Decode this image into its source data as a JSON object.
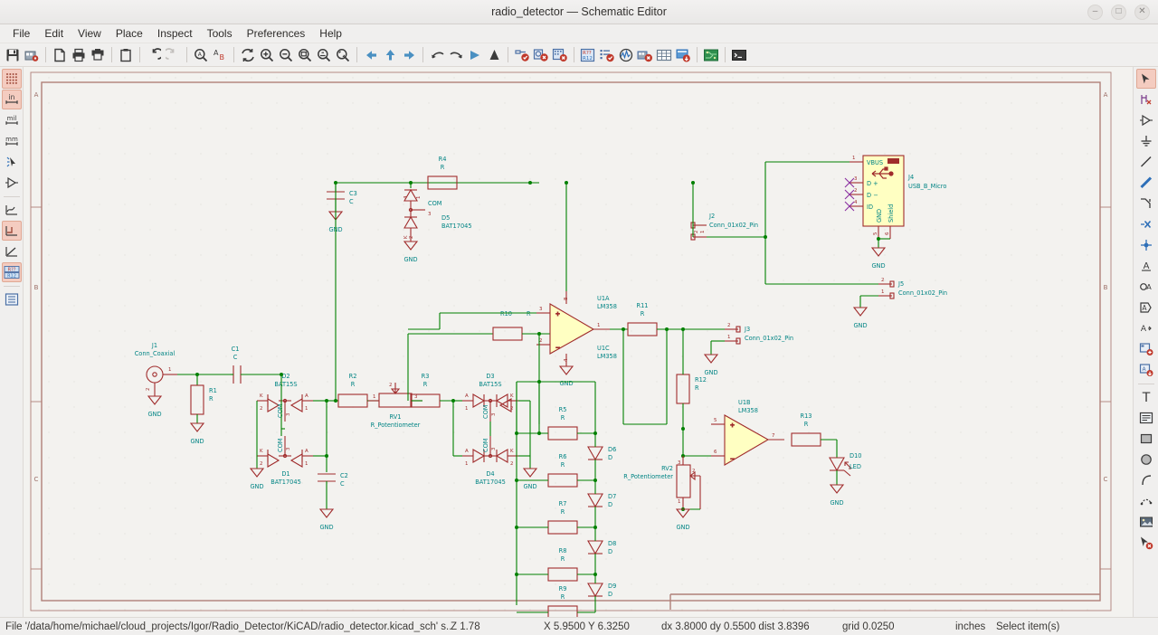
{
  "window": {
    "title": "radio_detector — Schematic Editor",
    "controls": [
      {
        "name": "minimize-button",
        "glyph": "–"
      },
      {
        "name": "maximize-button",
        "glyph": "□"
      },
      {
        "name": "close-button",
        "glyph": "✕"
      }
    ]
  },
  "menubar": {
    "items": [
      "File",
      "Edit",
      "View",
      "Place",
      "Inspect",
      "Tools",
      "Preferences",
      "Help"
    ]
  },
  "toolbar": {
    "groups": [
      [
        "save-icon",
        "project-manager-icon"
      ],
      [
        "new-sheet-icon",
        "print-icon",
        "plot-icon"
      ],
      [
        "paste-icon"
      ],
      [
        "undo-icon",
        "redo-icon"
      ],
      [
        "find-icon",
        "find-replace-icon"
      ],
      [
        "refresh-icon",
        "zoom-in-icon",
        "zoom-out-icon",
        "zoom-fit-icon",
        "zoom-objects-icon",
        "zoom-area-icon"
      ],
      [
        "back-icon",
        "up-icon",
        "forward-icon"
      ],
      [
        "rotate-ccw-icon",
        "rotate-cw-icon",
        "mirror-h-icon",
        "mirror-v-icon"
      ],
      [
        "annotate-icon",
        "symbol-checker-icon",
        "erc-icon"
      ],
      [
        "bom-icon",
        "fields-editor-icon",
        "simulator-icon",
        "assign-footprints-icon",
        "spreadsheet-icon",
        "netlist-icon"
      ],
      [
        "pcb-editor-icon"
      ],
      [
        "scripting-console-icon"
      ]
    ]
  },
  "left_toolbar": {
    "items": [
      {
        "name": "toggle-grid-icon",
        "active": true
      },
      {
        "name": "units-inches-icon",
        "label": "in",
        "active": true
      },
      {
        "name": "units-mils-icon",
        "label": "mil",
        "active": false
      },
      {
        "name": "units-mm-icon",
        "label": "mm",
        "active": false
      },
      {
        "name": "cursor-full-window-icon",
        "active": false
      },
      {
        "name": "hidden-pins-icon",
        "active": false
      },
      {
        "name": "free-angle-wires-icon",
        "active": false
      },
      {
        "name": "h-v-wires-icon",
        "active": true
      },
      {
        "name": "any-angle-wires-icon",
        "active": false
      },
      {
        "name": "show-pin-numbers-icon",
        "active": true
      },
      {
        "name": "show-hierarchy-navigator-icon",
        "active": false
      }
    ]
  },
  "right_toolbar": {
    "items": [
      {
        "name": "select-tool-icon",
        "active": true
      },
      {
        "name": "highlight-net-icon",
        "active": false
      },
      {
        "name": "place-symbol-icon",
        "active": false
      },
      {
        "name": "place-power-port-icon",
        "active": false
      },
      {
        "name": "draw-wire-icon",
        "active": false
      },
      {
        "name": "draw-bus-icon",
        "active": false
      },
      {
        "name": "wire-to-bus-entry-icon",
        "active": false
      },
      {
        "name": "no-connect-flag-icon",
        "active": false
      },
      {
        "name": "junction-icon",
        "active": false
      },
      {
        "name": "net-label-icon",
        "active": false
      },
      {
        "name": "global-label-icon",
        "active": false
      },
      {
        "name": "hierarchical-label-icon",
        "active": false
      },
      {
        "name": "text-label-icon",
        "active": false
      },
      {
        "name": "hierarchical-sheet-icon",
        "active": false
      },
      {
        "name": "import-sheet-pin-icon",
        "active": false
      },
      {
        "name": "draw-text-icon",
        "active": false
      },
      {
        "name": "draw-textbox-icon",
        "active": false
      },
      {
        "name": "draw-rectangle-icon",
        "active": false
      },
      {
        "name": "draw-circle-icon",
        "active": false
      },
      {
        "name": "draw-arc-icon",
        "active": false
      },
      {
        "name": "draw-lines-icon",
        "active": false
      },
      {
        "name": "place-image-icon",
        "active": false
      },
      {
        "name": "delete-tool-icon",
        "active": false
      }
    ]
  },
  "statusbar": {
    "file": "File '/data/home/michael/cloud_projects/Igor/Radio_Detector/KiCAD/radio_detector.kicad_sch' s...",
    "zoom": "Z 1.78",
    "absolute": "X 5.9500  Y 6.3250",
    "relative": "dx 3.8000  dy 0.5500  dist 3.8396",
    "grid": "grid 0.0250",
    "units": "inches",
    "tool": "Select item(s)"
  },
  "sheet": {
    "row_markers": [
      "A",
      "B",
      "C"
    ],
    "frame_color": "#b08078"
  },
  "schematic": {
    "wire_color": "#008000",
    "symbol_color": "#a02c2c",
    "label_color": "#008484",
    "pin_color": "#a02c2c",
    "body_fill": "#ffffc2",
    "components": [
      {
        "ref": "J1",
        "value": "Conn_Coaxial",
        "type": "coax-connector"
      },
      {
        "ref": "R1",
        "value": "R",
        "type": "resistor"
      },
      {
        "ref": "C1",
        "value": "C",
        "type": "capacitor"
      },
      {
        "ref": "C2",
        "value": "C",
        "type": "capacitor"
      },
      {
        "ref": "C3",
        "value": "C",
        "type": "capacitor"
      },
      {
        "ref": "D1",
        "value": "BAT17045",
        "type": "dual-diode"
      },
      {
        "ref": "D2",
        "value": "BAT15S",
        "type": "dual-diode"
      },
      {
        "ref": "D3",
        "value": "BAT15S",
        "type": "dual-diode"
      },
      {
        "ref": "D4",
        "value": "BAT17045",
        "type": "dual-diode"
      },
      {
        "ref": "D5",
        "value": "BAT17045",
        "type": "dual-diode"
      },
      {
        "ref": "D6",
        "value": "D",
        "type": "diode"
      },
      {
        "ref": "D7",
        "value": "D",
        "type": "diode"
      },
      {
        "ref": "D8",
        "value": "D",
        "type": "diode"
      },
      {
        "ref": "D9",
        "value": "D",
        "type": "diode"
      },
      {
        "ref": "D10",
        "value": "LED",
        "type": "led"
      },
      {
        "ref": "R2",
        "value": "R",
        "type": "resistor"
      },
      {
        "ref": "R3",
        "value": "R",
        "type": "resistor"
      },
      {
        "ref": "R4",
        "value": "R",
        "type": "resistor"
      },
      {
        "ref": "R5",
        "value": "R",
        "type": "resistor"
      },
      {
        "ref": "R6",
        "value": "R",
        "type": "resistor"
      },
      {
        "ref": "R7",
        "value": "R",
        "type": "resistor"
      },
      {
        "ref": "R8",
        "value": "R",
        "type": "resistor"
      },
      {
        "ref": "R9",
        "value": "R",
        "type": "resistor"
      },
      {
        "ref": "R10",
        "value": "R",
        "type": "resistor"
      },
      {
        "ref": "R11",
        "value": "R",
        "type": "resistor"
      },
      {
        "ref": "R12",
        "value": "R",
        "type": "resistor"
      },
      {
        "ref": "R13",
        "value": "R",
        "type": "resistor"
      },
      {
        "ref": "RV1",
        "value": "R_Potentiometer",
        "type": "potentiometer"
      },
      {
        "ref": "RV2",
        "value": "R_Potentiometer",
        "type": "potentiometer"
      },
      {
        "ref": "U1A",
        "value": "LM358",
        "type": "opamp"
      },
      {
        "ref": "U1C",
        "value": "LM358",
        "type": "opamp-power"
      },
      {
        "ref": "U1B",
        "value": "LM358",
        "type": "opamp"
      },
      {
        "ref": "J2",
        "value": "Conn_01x02_Pin",
        "type": "connector"
      },
      {
        "ref": "J3",
        "value": "Conn_01x02_Pin",
        "type": "connector"
      },
      {
        "ref": "J4",
        "value": "USB_B_Micro",
        "type": "usb-connector"
      },
      {
        "ref": "J5",
        "value": "Conn_01x02_Pin",
        "type": "connector"
      }
    ],
    "usb_pins": [
      "VBUS",
      "D +",
      "D −",
      "ID",
      "GND",
      "Shield"
    ],
    "power_label": "GND",
    "diode_pin_labels": {
      "anode": "A",
      "cathode": "K",
      "common": "COM"
    }
  }
}
